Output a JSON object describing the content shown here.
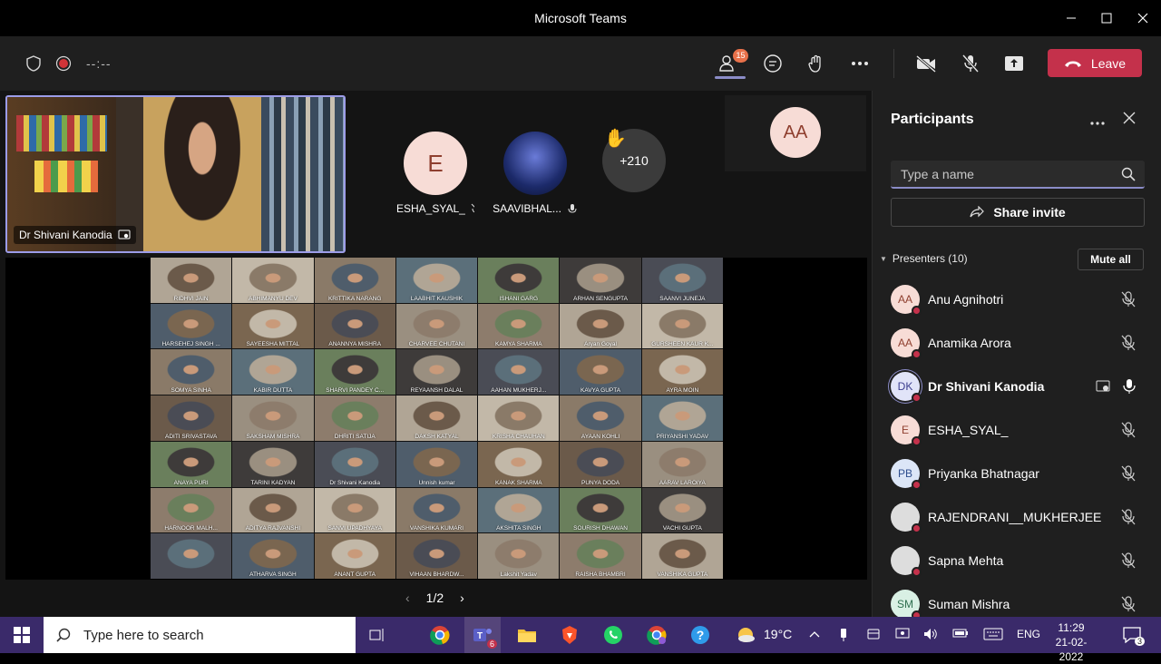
{
  "window": {
    "title": "Microsoft Teams"
  },
  "toolbar": {
    "timer": "--:--",
    "participant_count": "15",
    "leave_label": "Leave"
  },
  "stage": {
    "main_video_name": "Dr Shivani Kanodia",
    "tiles": [
      {
        "initial": "E",
        "name": "ESHA_SYAL_"
      },
      {
        "initial": "",
        "name": "SAAVIBHAL..."
      }
    ],
    "overflow_count": "+210",
    "extra_avatar": "AA"
  },
  "grid_names": [
    "RIDHVI JAIN",
    "ABHIMANYU DEV",
    "KRITTIKA NARANG",
    "LAABHIT KAUSHIK",
    "ISHANI GARG",
    "ARHAN SENGUPTA",
    "SAANVI JUNEJA",
    "HARSEHEJ SINGH ...",
    "SAYEESHA MITTAL",
    "ANANNYA MISHRA",
    "CHARVEE CHUTANI",
    "KAMYA SHARMA",
    "Aryan Goyal",
    "GURSHEEN KAUR K...",
    "SOMYA SINHA",
    "KABIR DUTTA",
    "SHARVI PANDEY C...",
    "REYAANSH DALAL",
    "AAHAN MUKHERJ...",
    "KAVYA GUPTA",
    "AYRA MOIN",
    "ADITI SRIVASTAVA",
    "SAKSHAM MISHRA",
    "DHRITI SATIJA",
    "DAKSH KATYAL",
    "KRISHA CHAUHAN",
    "AYAAN KOHLI",
    "PRIYANSHI YADAV",
    "ANAYA PURI",
    "TARINI KADYAN",
    "Dr Shivani Kanodia",
    "Unnish kumar",
    "KANAK SHARMA",
    "PUNYA DODA",
    "AARAV LAROIYA",
    "HARNOOR MALH...",
    "ADITYA RAJVANSHI",
    "SANVI UPADHYAYA",
    "VANSHIKA KUMARI",
    "AKSHITA SINGH",
    "SOURISH DHAWAN",
    "VACHI GUPTA",
    "",
    "ATHARVA SINGH",
    "ANANT GUPTA",
    "VIHAAN BHARDW...",
    "Lakshit Yadav",
    "RAISHA BHAMBRI",
    "VANSHIKA GUPTA"
  ],
  "pager": {
    "label": "1/2"
  },
  "panel": {
    "title": "Participants",
    "search_placeholder": "Type a name",
    "share_invite": "Share invite",
    "section_label": "Presenters (10)",
    "mute_all": "Mute all",
    "participants": [
      {
        "initials": "AA",
        "name": "Anu Agnihotri",
        "bold": false
      },
      {
        "initials": "AA",
        "name": "Anamika Arora",
        "bold": false
      },
      {
        "initials": "DK",
        "name": "Dr Shivani Kanodia",
        "bold": true
      },
      {
        "initials": "E",
        "name": "ESHA_SYAL_",
        "bold": false
      },
      {
        "initials": "PB",
        "name": "Priyanka Bhatnagar",
        "bold": false
      },
      {
        "initials": "",
        "name": "RAJENDRANI__MUKHERJEE",
        "bold": false
      },
      {
        "initials": "",
        "name": "Sapna Mehta",
        "bold": false
      },
      {
        "initials": "SM",
        "name": "Suman Mishra",
        "bold": false
      }
    ]
  },
  "taskbar": {
    "search_placeholder": "Type here to search",
    "teams_badge": "6",
    "temperature": "19°C",
    "language": "ENG",
    "time": "11:29",
    "date": "21-02-2022",
    "notification_count": "3"
  },
  "colors": {
    "accent": "#8b8cc7",
    "leave": "#c4314b",
    "taskbar": "#3a2a6a",
    "panel": "#1f1f1f"
  }
}
